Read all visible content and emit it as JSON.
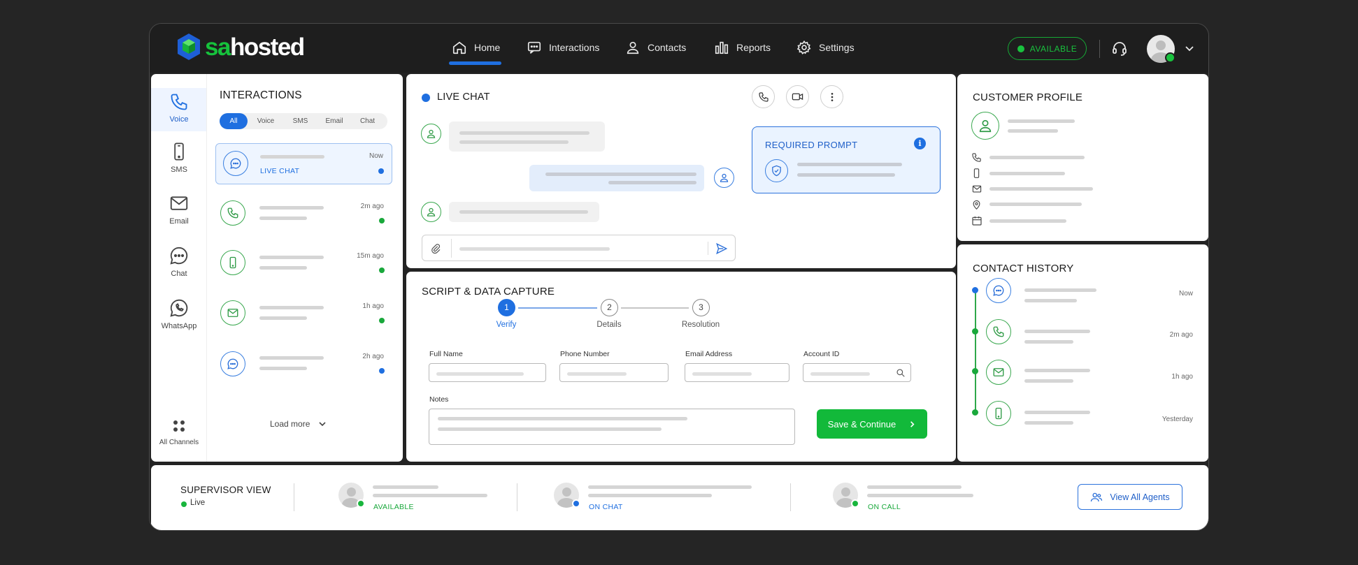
{
  "brand": {
    "logo_part1": "sa",
    "logo_part2": "hosted",
    "colors": {
      "accent": "#1f6fe0",
      "green": "#16b93a",
      "dark": "#1e1e1e"
    }
  },
  "nav": {
    "items": [
      {
        "label": "Home",
        "icon": "home-icon",
        "active": true
      },
      {
        "label": "Interactions",
        "icon": "chat-bubble-icon"
      },
      {
        "label": "Contacts",
        "icon": "user-icon"
      },
      {
        "label": "Reports",
        "icon": "bar-chart-icon"
      },
      {
        "label": "Settings",
        "icon": "gear-icon"
      }
    ],
    "status_label": "AVAILABLE"
  },
  "channels": {
    "items": [
      {
        "label": "Voice",
        "icon": "phone-icon",
        "active": true
      },
      {
        "label": "SMS",
        "icon": "mobile-icon"
      },
      {
        "label": "Email",
        "icon": "mail-icon"
      },
      {
        "label": "Chat",
        "icon": "chat-dots-icon"
      },
      {
        "label": "WhatsApp",
        "icon": "whatsapp-icon"
      }
    ],
    "all_label": "All Channels"
  },
  "interactions": {
    "title": "INTERACTIONS",
    "filters": [
      "All",
      "Voice",
      "SMS",
      "Email",
      "Chat"
    ],
    "items": [
      {
        "type": "chat",
        "label": "LIVE CHAT",
        "time": "Now"
      },
      {
        "type": "voice",
        "time": "2m ago"
      },
      {
        "type": "sms",
        "time": "15m ago"
      },
      {
        "type": "email",
        "time": "1h ago"
      },
      {
        "type": "chat",
        "time": "2h ago"
      }
    ],
    "load_more": "Load more"
  },
  "livechat": {
    "title": "LIVE CHAT",
    "required_prompt": "REQUIRED PROMPT",
    "info_glyph": "i"
  },
  "script": {
    "title": "SCRIPT & DATA CAPTURE",
    "steps": [
      {
        "num": "1",
        "label": "Verify",
        "active": true
      },
      {
        "num": "2",
        "label": "Details"
      },
      {
        "num": "3",
        "label": "Resolution"
      }
    ],
    "fields": {
      "full_name": "Full Name",
      "phone": "Phone Number",
      "email": "Email Address",
      "account": "Account ID",
      "notes": "Notes"
    },
    "save_label": "Save & Continue"
  },
  "profile": {
    "title": "CUSTOMER PROFILE"
  },
  "history": {
    "title": "CONTACT HISTORY",
    "items": [
      {
        "type": "chat",
        "time": "Now"
      },
      {
        "type": "voice",
        "time": "2m ago"
      },
      {
        "type": "email",
        "time": "1h ago"
      },
      {
        "type": "sms",
        "time": "Yesterday"
      }
    ]
  },
  "supervisor": {
    "title": "SUPERVISOR VIEW",
    "live_label": "Live",
    "agents": [
      {
        "status": "AVAILABLE",
        "color": "#19b53d"
      },
      {
        "status": "ON CHAT",
        "color": "#1f6fe0"
      },
      {
        "status": "ON CALL",
        "color": "#19b53d"
      }
    ],
    "view_all": "View All Agents"
  }
}
